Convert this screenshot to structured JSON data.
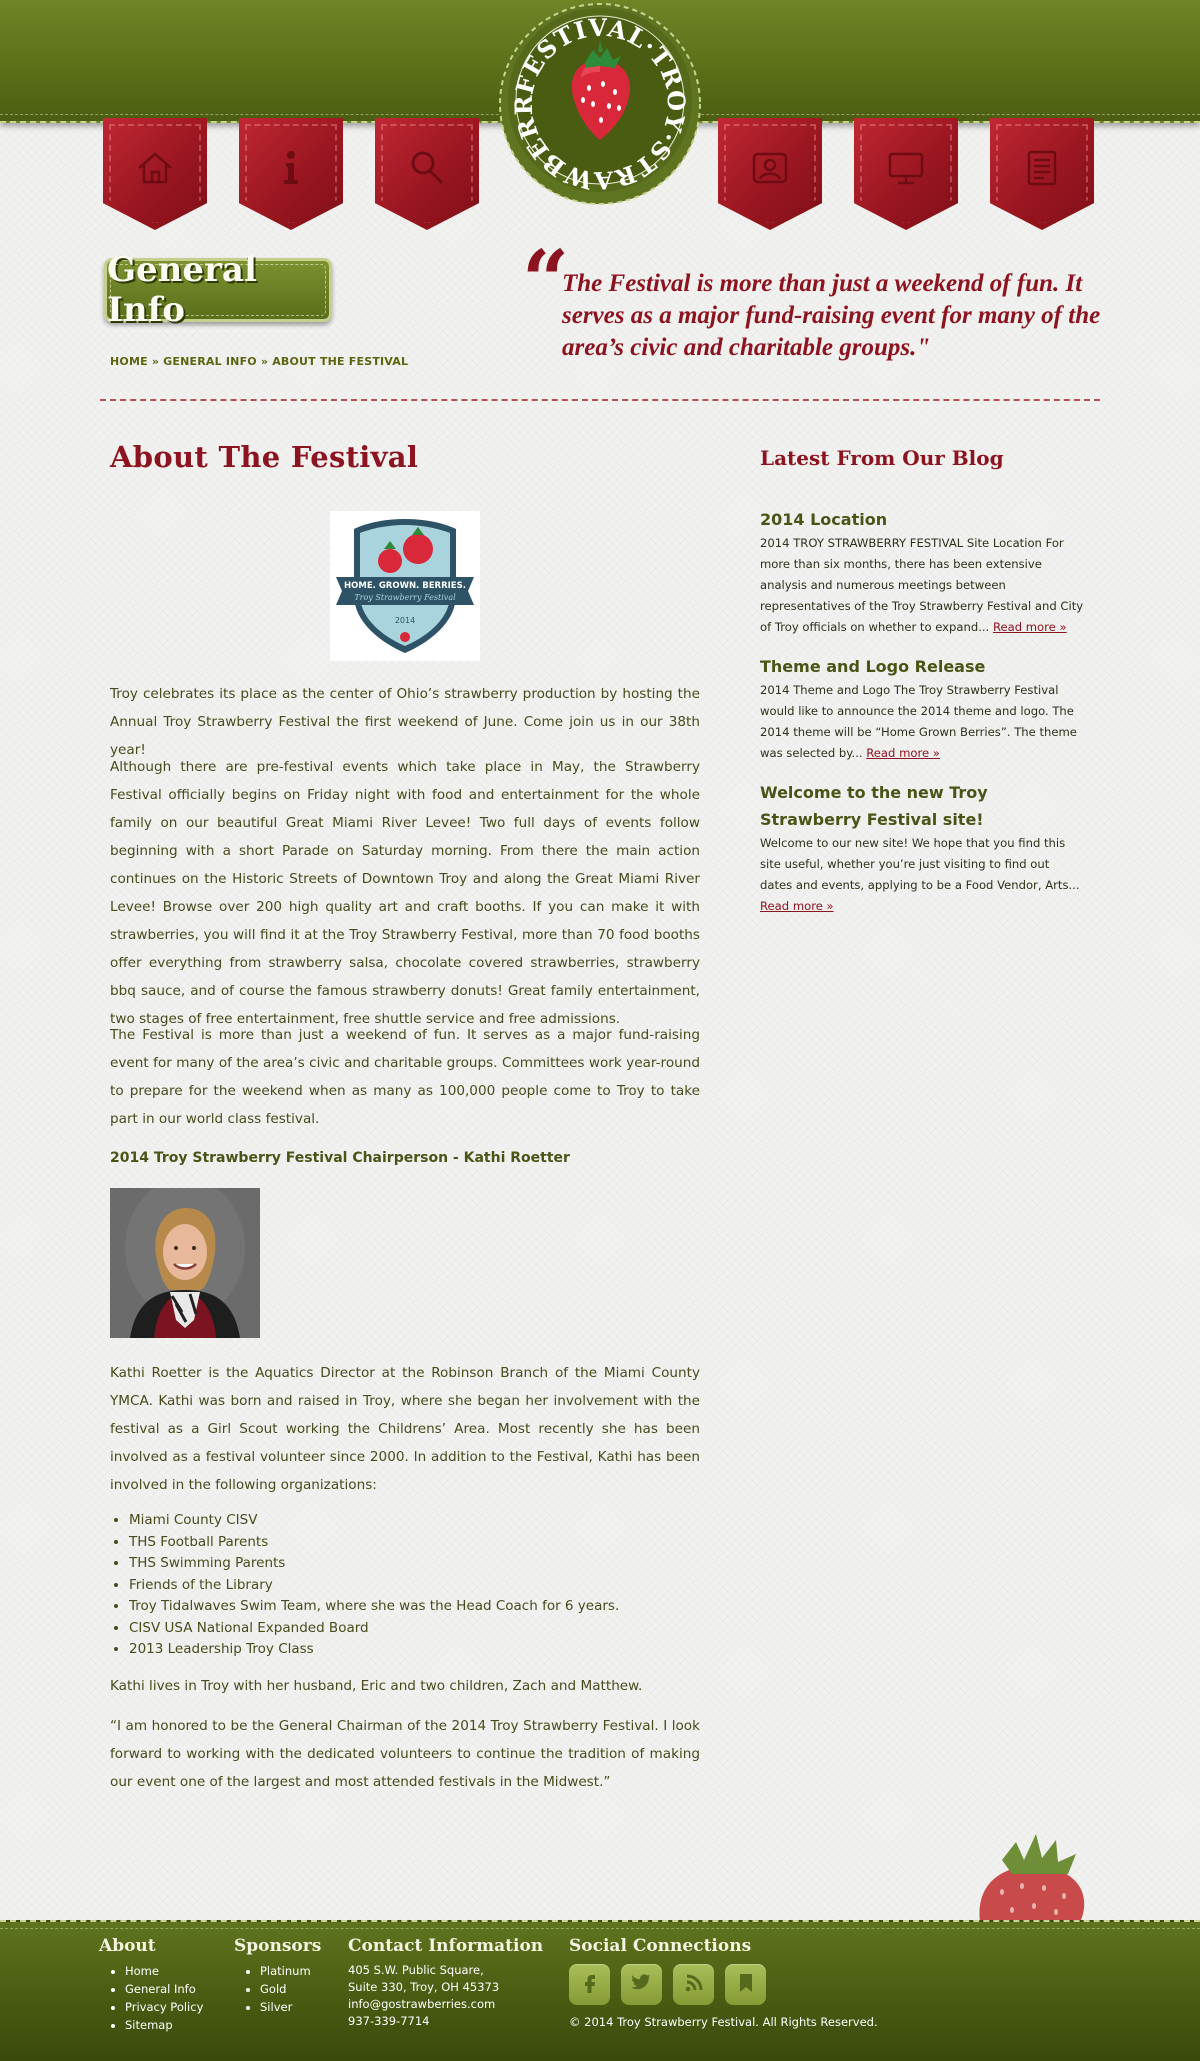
{
  "header": {
    "logo_text": "FESTIVAL·TROY·STRAWBERRY",
    "nav": [
      {
        "icon": "home-icon",
        "label": "Home"
      },
      {
        "icon": "info-icon",
        "label": "Info"
      },
      {
        "icon": "search-icon",
        "label": "Search"
      },
      {
        "icon": "person-icon",
        "label": "Contact"
      },
      {
        "icon": "monitor-icon",
        "label": "Media"
      },
      {
        "icon": "document-icon",
        "label": "Documents"
      }
    ]
  },
  "section": {
    "badge": "General Info",
    "breadcrumb": "HOME » GENERAL INFO » ABOUT THE FESTIVAL",
    "quote_mark": "“",
    "quote": "The Festival is more than just a weekend of fun. It serves as a major fund-raising event for many of the area’s civic and charitable groups.\""
  },
  "main": {
    "title": "About The Festival",
    "logo_banner": "HOME. GROWN. BERRIES.",
    "logo_sub": "Troy Strawberry Festival",
    "logo_year": "2014",
    "p1": "Troy celebrates its place as the center of Ohio’s strawberry production by hosting the Annual Troy Strawberry Festival the first weekend of June. Come join us in our 38th year!",
    "p2": "Although there are pre-festival events which take place in May, the Strawberry Festival officially begins on Friday night with food and entertainment for the whole family on our beautiful Great Miami River Levee! Two full days of events follow beginning with a short Parade on Saturday morning. From there the main action continues on the Historic Streets of Downtown Troy and along the Great Miami River Levee! Browse over 200 high quality art and craft booths. If you can make it with strawberries, you will find it at the Troy Strawberry Festival, more than 70 food booths offer everything from strawberry salsa, chocolate covered strawberries, strawberry bbq sauce, and of course the famous strawberry donuts! Great family entertainment, two stages of free entertainment, free shuttle service and free admissions.",
    "p3": "The Festival is more than just a weekend of fun. It serves as a major fund-raising event for many of the area’s civic and charitable groups. Committees work year-round to prepare for the weekend when as many as 100,000 people come to Troy to take part in our world class festival.",
    "chair_heading": "2014 Troy Strawberry Festival Chairperson - Kathi Roetter",
    "p4": "Kathi Roetter is the Aquatics Director at the Robinson Branch of the Miami County YMCA. Kathi was born and raised in Troy, where she began her involvement with the festival as a Girl Scout working the Childrens’ Area.  Most recently she has been involved as a festival volunteer since 2000.  In addition to the Festival, Kathi has been involved in the following organizations:",
    "orgs": [
      "Miami County CISV",
      "THS Football Parents",
      "THS Swimming Parents",
      "Friends of the Library",
      "Troy Tidalwaves Swim Team, where she was the Head Coach for 6 years.",
      "CISV USA National Expanded Board",
      "2013 Leadership Troy Class"
    ],
    "p5": "Kathi lives in Troy with her husband, Eric and two children, Zach and Matthew.",
    "p6": "“I am honored to be the General Chairman of the 2014 Troy Strawberry Festival. I look forward to working with the dedicated volunteers to continue the tradition of making our event one of the largest and most attended festivals in the Midwest.”"
  },
  "sidebar": {
    "title": "Latest From Our Blog",
    "posts": [
      {
        "title": "2014 Location",
        "excerpt": "2014 TROY STRAWBERRY FESTIVAL Site Location   For more than six months, there has been extensive analysis and numerous meetings between representatives of the Troy Strawberry Festival and City of Troy officials on whether to expand...",
        "more": "Read more »"
      },
      {
        "title": "Theme and Logo Release",
        "excerpt": "2014 Theme and Logo The Troy Strawberry Festival would like to announce the 2014 theme and logo. The 2014 theme will be “Home Grown Berries”. The theme was selected by...",
        "more": "Read more »"
      },
      {
        "title": "Welcome to the new Troy Strawberry Festival site!",
        "excerpt": "Welcome to our new site! We hope that you find this site useful, whether you’re just visiting to find out dates and events, applying to be a Food Vendor, Arts...",
        "more": "Read more »"
      }
    ]
  },
  "footer": {
    "about": {
      "heading": "About",
      "links": [
        "Home",
        "General Info",
        "Privacy Policy",
        "Sitemap"
      ]
    },
    "sponsors": {
      "heading": "Sponsors",
      "links": [
        "Platinum",
        "Gold",
        "Silver"
      ]
    },
    "contact": {
      "heading": "Contact Information",
      "line1": "405 S.W. Public Square,",
      "line2": "Suite 330, Troy, OH 45373",
      "email": "info@gostrawberries.com",
      "phone": "937-339-7714"
    },
    "social": {
      "heading": "Social Connections",
      "icons": [
        "facebook-icon",
        "twitter-icon",
        "rss-icon",
        "bookmark-icon"
      ],
      "copyright": "© 2014 Troy Strawberry Festival. All Rights Reserved."
    }
  },
  "colors": {
    "header_green": "#5c7019",
    "accent_red": "#8c1420",
    "text_olive": "#4a4a1c"
  }
}
